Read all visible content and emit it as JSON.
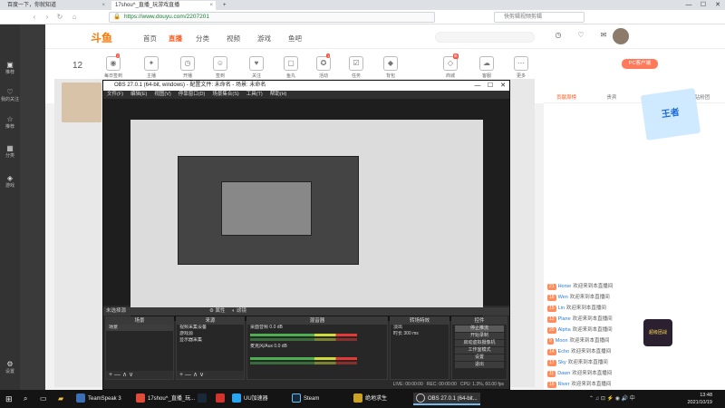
{
  "browser": {
    "tabs": [
      {
        "label": "百度一下，你就知道",
        "close": "×"
      },
      {
        "label": "17shou^_直播_玩游戏直播",
        "close": "×"
      },
      {
        "label": "+",
        "close": ""
      }
    ],
    "url": "https://www.douyu.com/2207201",
    "search_placeholder": "快剪辑视频剪辑",
    "window_buttons": [
      "—",
      "☐",
      "✕"
    ]
  },
  "left_sidebar": {
    "items": [
      "推荐",
      "我的关注",
      "推荐",
      "分类",
      "游戏",
      "设置"
    ]
  },
  "site": {
    "logo": "斗鱼",
    "nav": [
      "首页",
      "直播",
      "分类",
      "视频",
      "游戏",
      "鱼吧"
    ],
    "active_nav": "直播",
    "categories": [
      {
        "label": "每日签到",
        "badge": "2"
      },
      {
        "label": "主播",
        "badge": ""
      },
      {
        "label": "开播",
        "badge": ""
      },
      {
        "label": "签到",
        "badge": ""
      },
      {
        "label": "关注",
        "badge": ""
      },
      {
        "label": "鱼丸",
        "badge": ""
      },
      {
        "label": "活动",
        "badge": "1"
      },
      {
        "label": "任务",
        "badge": ""
      },
      {
        "label": "背包",
        "badge": ""
      },
      {
        "label": "商城",
        "badge": "新"
      },
      {
        "label": "客服",
        "badge": ""
      },
      {
        "label": "更多",
        "badge": ""
      }
    ],
    "day_number": "12",
    "pc_button": "PC客户端",
    "chat_tabs": [
      "贡献周榜",
      "贵宾",
      "粉丝团",
      "钻粉团"
    ],
    "chat_rows": [
      {
        "name": "Horse",
        "text": "欢迎来到本直播间"
      },
      {
        "name": "Wen",
        "text": "欢迎来到本直播间"
      },
      {
        "name": "Lin",
        "text": "欢迎来到本直播间"
      },
      {
        "name": "Plane",
        "text": "欢迎来到本直播间"
      },
      {
        "name": "Alpha",
        "text": "欢迎来到本直播间"
      },
      {
        "name": "Moon",
        "text": "欢迎来到本直播间"
      },
      {
        "name": "Echo",
        "text": "欢迎来到本直播间"
      },
      {
        "name": "Sky",
        "text": "欢迎来到本直播间"
      },
      {
        "name": "Dawn",
        "text": "欢迎来到本直播间"
      },
      {
        "name": "River",
        "text": "欢迎来到本直播间"
      },
      {
        "name": "Stone",
        "text": "欢迎来到本直播间"
      }
    ],
    "gift_label": "超级团战",
    "poster_text": "王者"
  },
  "obs": {
    "title": "OBS 27.0.1 (64-bit, windows) - 配置文件: 未命名 - 场景: 未命名",
    "menu": [
      "文件(F)",
      "编辑(E)",
      "视图(V)",
      "停靠窗口(D)",
      "场景集合(S)",
      "工具(T)",
      "帮助(H)"
    ],
    "status_band": "未选择源",
    "props_btn": "属性",
    "filter_btn": "滤镜",
    "scenes_title": "场景",
    "scenes": [
      "场景"
    ],
    "sources_title": "来源",
    "sources": [
      "视频采集设备",
      "游戏源",
      "显示器采集"
    ],
    "mixer_title": "混音器",
    "mixer": [
      {
        "name": "桌面音频",
        "db": "0.0 dB"
      },
      {
        "name": "麦克风/Aux",
        "db": "0.0 dB"
      }
    ],
    "transitions_title": "转场特效",
    "transition_name": "淡出",
    "duration_label": "时长",
    "duration_value": "300 ms",
    "controls_title": "控件",
    "controls": [
      "停止推流",
      "开始录制",
      "启动虚拟摄像机",
      "工作室模式",
      "设置",
      "退出"
    ],
    "status_live": "LIVE: 00:00:00",
    "status_rec": "REC: 00:00:00",
    "status_cpu": "CPU: 1.3%, 60.00 fps",
    "foot_add": "+ — ∧ ∨"
  },
  "taskbar": {
    "items": [
      "TeamSpeak 3",
      "17shou^_直播_玩...",
      "UU加速器",
      "Steam",
      "绝地求生",
      "OBS 27.0.1 (64-bit..."
    ],
    "time": "13:48",
    "date": "2021/10/19"
  }
}
